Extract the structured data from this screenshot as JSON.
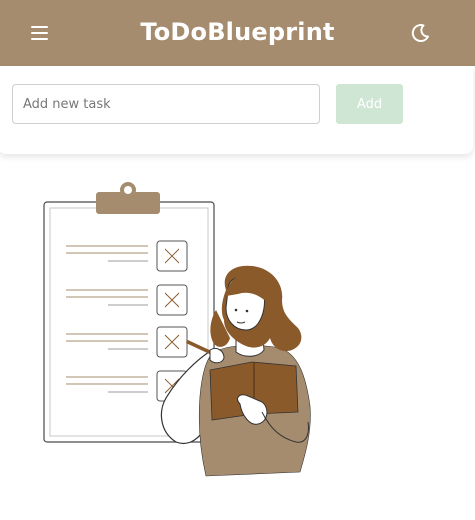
{
  "app": {
    "title": "ToDoBlueprint"
  },
  "header": {
    "menu_icon": "hamburger-menu-icon",
    "theme_icon": "moon-icon"
  },
  "new_task": {
    "value": "",
    "placeholder": "Add new task",
    "add_label": "Add"
  },
  "colors": {
    "brand": "#a68c6e",
    "add_button": "#cfe6d5",
    "illustration_accent": "#8a5a2b"
  },
  "illustration": {
    "name": "empty-list-illustration"
  }
}
